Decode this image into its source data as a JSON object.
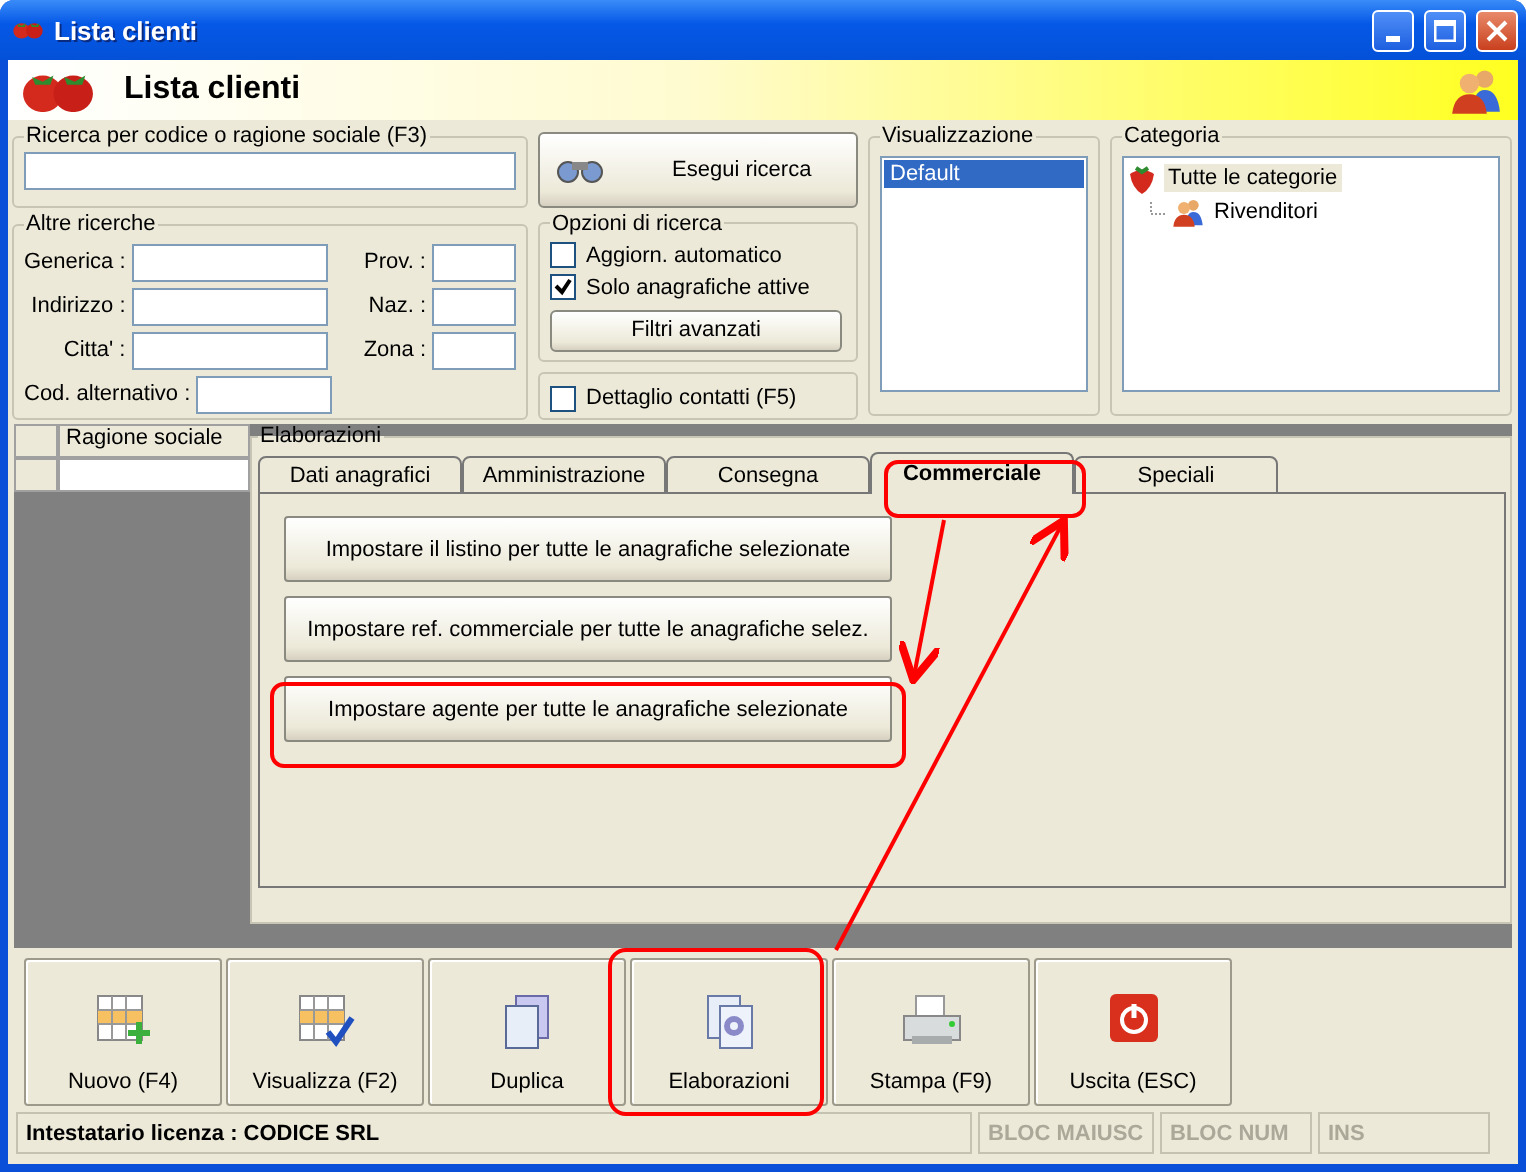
{
  "window": {
    "title": "Lista clienti"
  },
  "header": {
    "title": "Lista clienti"
  },
  "quick_search": {
    "label": "Ricerca per codice o ragione sociale (F3)"
  },
  "search_button": {
    "label": "Esegui ricerca"
  },
  "other_searches": {
    "label": "Altre ricerche",
    "left_fields": [
      {
        "label": "Generica :"
      },
      {
        "label": "Indirizzo :"
      },
      {
        "label": "Citta' :"
      }
    ],
    "right_fields": [
      {
        "label": "Prov. :"
      },
      {
        "label": "Naz. :"
      },
      {
        "label": "Zona :"
      }
    ],
    "alt_code": {
      "label": "Cod. alternativo :"
    }
  },
  "search_options": {
    "label": "Opzioni di ricerca",
    "options": [
      {
        "label": "Aggiorn. automatico",
        "checked": false
      },
      {
        "label": "Solo anagrafiche attive",
        "checked": true
      }
    ],
    "button": "Filtri avanzati"
  },
  "contact_detail": {
    "label": "Dettaglio contatti (F5)",
    "checked": false
  },
  "view": {
    "label": "Visualizzazione",
    "items": [
      {
        "label": "Default",
        "selected": true
      }
    ]
  },
  "category": {
    "label": "Categoria",
    "tree": [
      {
        "label": "Tutte le categorie",
        "kind": "root",
        "selected": true,
        "children": [
          {
            "label": "Rivenditori",
            "kind": "group",
            "selected": false
          }
        ]
      }
    ]
  },
  "grid": {
    "columns": [
      "Ragione sociale"
    ]
  },
  "processing": {
    "label": "Elaborazioni",
    "tabs": [
      {
        "label": "Dati anagrafici",
        "selected": false
      },
      {
        "label": "Amministrazione",
        "selected": false
      },
      {
        "label": "Consegna",
        "selected": false
      },
      {
        "label": "Commerciale",
        "selected": true
      },
      {
        "label": "Speciali",
        "selected": false
      }
    ],
    "actions": [
      "Impostare il listino per tutte le anagrafiche selezionate",
      "Impostare ref. commerciale per tutte le anagrafiche selez.",
      "Impostare agente per tutte le anagrafiche selezionate"
    ]
  },
  "toolbar": [
    {
      "label": "Nuovo (F4)",
      "kind": "new"
    },
    {
      "label": "Visualizza (F2)",
      "kind": "view"
    },
    {
      "label": "Duplica",
      "kind": "duplicate"
    },
    {
      "label": "Elaborazioni",
      "kind": "process"
    },
    {
      "label": "Stampa (F9)",
      "kind": "print"
    },
    {
      "label": "Uscita (ESC)",
      "kind": "exit"
    }
  ],
  "status_bar": {
    "license": "Intestatario licenza : CODICE SRL",
    "indicators": [
      {
        "label": "BLOC MAIUSC",
        "disabled": true
      },
      {
        "label": "BLOC NUM",
        "disabled": true
      },
      {
        "label": "INS",
        "disabled": true
      }
    ]
  }
}
